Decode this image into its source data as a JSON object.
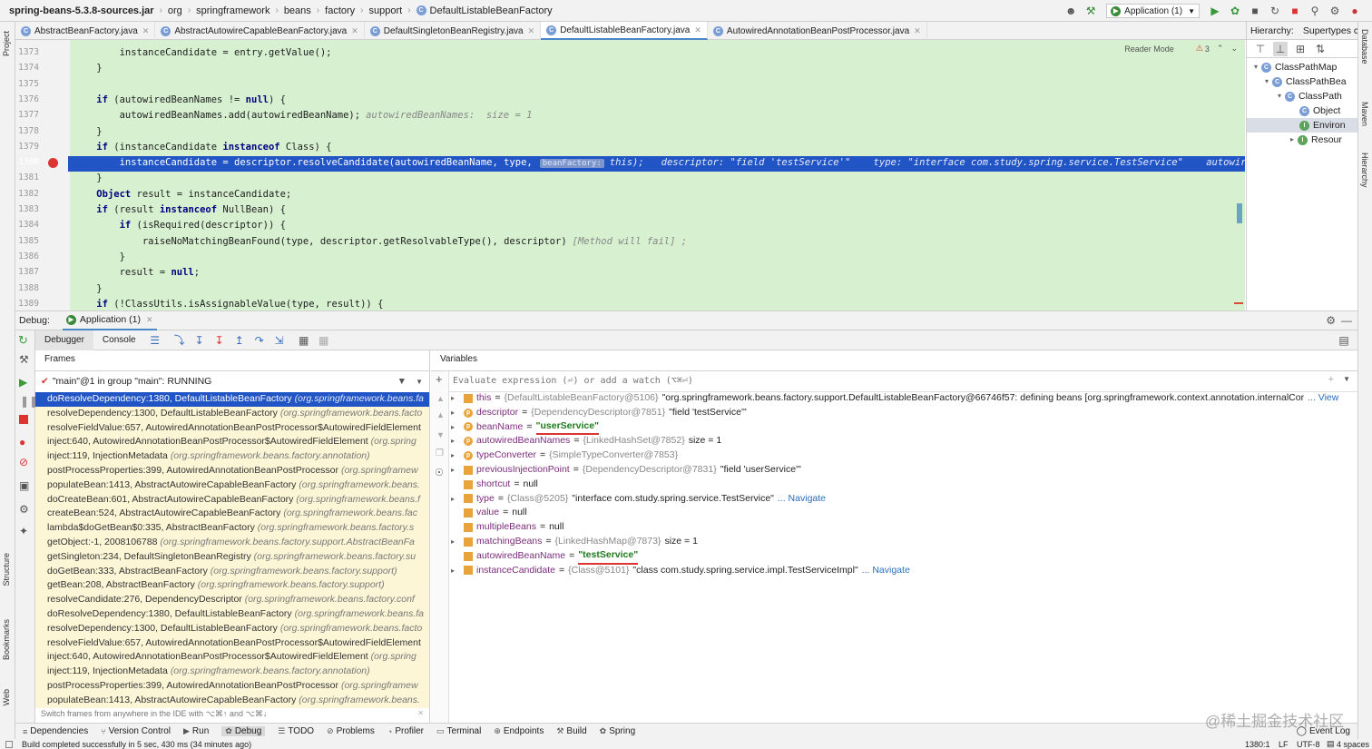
{
  "nav": {
    "breadcrumbs": [
      "spring-beans-5.3.8-sources.jar",
      "org",
      "springframework",
      "beans",
      "factory",
      "support",
      "DefaultListableBeanFactory"
    ],
    "run_config": "Application (1)"
  },
  "tabs": [
    "AbstractBeanFactory.java",
    "AbstractAutowireCapableBeanFactory.java",
    "DefaultSingletonBeanRegistry.java",
    "DefaultListableBeanFactory.java",
    "AutowiredAnnotationBeanPostProcessor.java"
  ],
  "left_tools": [
    "Project",
    "Structure",
    "Bookmarks",
    "Web"
  ],
  "right_tools": [
    "Database",
    "Maven",
    "Hierarchy"
  ],
  "editor": {
    "reader_mode": "Reader Mode",
    "warnings": "3",
    "lines": [
      {
        "n": "1373",
        "text": "        instanceCandidate = entry.getValue();"
      },
      {
        "n": "1374",
        "text": "    }"
      },
      {
        "n": "1375",
        "text": ""
      },
      {
        "n": "1376",
        "text": "    if (autowiredBeanNames != null) {"
      },
      {
        "n": "1377",
        "text": "        autowiredBeanNames.add(autowiredBeanName);",
        "hint": "autowiredBeanNames:  size = 1"
      },
      {
        "n": "1378",
        "text": "    }"
      },
      {
        "n": "1379",
        "text": "    if (instanceCandidate instanceof Class) {"
      },
      {
        "n": "1380",
        "text": "        instanceCandidate = descriptor.resolveCandidate(autowiredBeanName, type,",
        "hint": "this);   descriptor: \"field 'testService'\"    type: \"interface com.study.spring.service.TestService\"    autowir"
      },
      {
        "n": "1381",
        "text": "    }"
      },
      {
        "n": "1382",
        "text": "    Object result = instanceCandidate;"
      },
      {
        "n": "1383",
        "text": "    if (result instanceof NullBean) {"
      },
      {
        "n": "1384",
        "text": "        if (isRequired(descriptor)) {"
      },
      {
        "n": "1385",
        "text": "            raiseNoMatchingBeanFound(type, descriptor.getResolvableType(), descriptor)",
        "hint": "[Method will fail] ;"
      },
      {
        "n": "1386",
        "text": "        }"
      },
      {
        "n": "1387",
        "text": "        result = null;"
      },
      {
        "n": "1388",
        "text": "    }"
      },
      {
        "n": "1389",
        "text": "    if (!ClassUtils.isAssignableValue(type, result)) {"
      }
    ],
    "inlay_param": "beanFactory:"
  },
  "hierarchy": {
    "title": "Hierarchy:",
    "tab": "Supertypes c",
    "items": [
      "ClassPathMap",
      "ClassPathBea",
      "ClassPath",
      "Object",
      "Environ",
      "Resour"
    ]
  },
  "debug": {
    "label": "Debug:",
    "session": "Application (1)",
    "tabs": [
      "Debugger",
      "Console"
    ],
    "frames_title": "Frames",
    "thread": "\"main\"@1 in group \"main\": RUNNING",
    "frames": [
      {
        "m": "doResolveDependency:1380, DefaultListableBeanFactory",
        "p": "(org.springframework.beans.fa"
      },
      {
        "m": "resolveDependency:1300, DefaultListableBeanFactory",
        "p": "(org.springframework.beans.facto"
      },
      {
        "m": "resolveFieldValue:657, AutowiredAnnotationBeanPostProcessor$AutowiredFieldElement",
        "p": ""
      },
      {
        "m": "inject:640, AutowiredAnnotationBeanPostProcessor$AutowiredFieldElement",
        "p": "(org.spring"
      },
      {
        "m": "inject:119, InjectionMetadata",
        "p": "(org.springframework.beans.factory.annotation)"
      },
      {
        "m": "postProcessProperties:399, AutowiredAnnotationBeanPostProcessor",
        "p": "(org.springframew"
      },
      {
        "m": "populateBean:1413, AbstractAutowireCapableBeanFactory",
        "p": "(org.springframework.beans."
      },
      {
        "m": "doCreateBean:601, AbstractAutowireCapableBeanFactory",
        "p": "(org.springframework.beans.f"
      },
      {
        "m": "createBean:524, AbstractAutowireCapableBeanFactory",
        "p": "(org.springframework.beans.fac"
      },
      {
        "m": "lambda$doGetBean$0:335, AbstractBeanFactory",
        "p": "(org.springframework.beans.factory.s"
      },
      {
        "m": "getObject:-1, 2008106788",
        "p": "(org.springframework.beans.factory.support.AbstractBeanFa"
      },
      {
        "m": "getSingleton:234, DefaultSingletonBeanRegistry",
        "p": "(org.springframework.beans.factory.su"
      },
      {
        "m": "doGetBean:333, AbstractBeanFactory",
        "p": "(org.springframework.beans.factory.support)"
      },
      {
        "m": "getBean:208, AbstractBeanFactory",
        "p": "(org.springframework.beans.factory.support)"
      },
      {
        "m": "resolveCandidate:276, DependencyDescriptor",
        "p": "(org.springframework.beans.factory.conf"
      },
      {
        "m": "doResolveDependency:1380, DefaultListableBeanFactory",
        "p": "(org.springframework.beans.fa"
      },
      {
        "m": "resolveDependency:1300, DefaultListableBeanFactory",
        "p": "(org.springframework.beans.facto"
      },
      {
        "m": "resolveFieldValue:657, AutowiredAnnotationBeanPostProcessor$AutowiredFieldElement",
        "p": ""
      },
      {
        "m": "inject:640, AutowiredAnnotationBeanPostProcessor$AutowiredFieldElement",
        "p": "(org.spring"
      },
      {
        "m": "inject:119, InjectionMetadata",
        "p": "(org.springframework.beans.factory.annotation)"
      },
      {
        "m": "postProcessProperties:399, AutowiredAnnotationBeanPostProcessor",
        "p": "(org.springframew"
      },
      {
        "m": "populateBean:1413, AbstractAutowireCapableBeanFactory",
        "p": "(org.springframework.beans."
      }
    ],
    "frames_tip": "Switch frames from anywhere in the IDE with ⌥⌘↑ and ⌥⌘↓",
    "vars_title": "Variables",
    "eval_placeholder": "Evaluate expression (⏎) or add a watch (⌥⌘⏎)",
    "vars": [
      {
        "exp": true,
        "icon": "f",
        "name": "this",
        "type": "{DefaultListableBeanFactory@5106}",
        "val": "\"org.springframework.beans.factory.support.DefaultListableBeanFactory@66746f57: defining beans [org.springframework.context.annotation.internalCor",
        "link": "... View"
      },
      {
        "exp": true,
        "icon": "p",
        "name": "descriptor",
        "type": "{DependencyDescriptor@7851}",
        "val": "\"field 'testService'\"",
        "link": ""
      },
      {
        "exp": true,
        "icon": "p",
        "name": "beanName",
        "type": "",
        "str": "\"userService\"",
        "link": ""
      },
      {
        "exp": true,
        "icon": "p",
        "name": "autowiredBeanNames",
        "type": "{LinkedHashSet@7852}",
        "val": " size = 1",
        "link": ""
      },
      {
        "exp": true,
        "icon": "p",
        "name": "typeConverter",
        "type": "{SimpleTypeConverter@7853}",
        "val": "",
        "link": ""
      },
      {
        "exp": true,
        "icon": "f",
        "name": "previousInjectionPoint",
        "type": "{DependencyDescriptor@7831}",
        "val": "\"field 'userService'\"",
        "link": ""
      },
      {
        "exp": false,
        "icon": "f",
        "name": "shortcut",
        "type": "",
        "val": "null",
        "link": ""
      },
      {
        "exp": true,
        "icon": "f",
        "name": "type",
        "type": "{Class@5205}",
        "val": "\"interface com.study.spring.service.TestService\"",
        "link": "... Navigate"
      },
      {
        "exp": false,
        "icon": "f",
        "name": "value",
        "type": "",
        "val": "null",
        "link": ""
      },
      {
        "exp": false,
        "icon": "f",
        "name": "multipleBeans",
        "type": "",
        "val": "null",
        "link": ""
      },
      {
        "exp": true,
        "icon": "f",
        "name": "matchingBeans",
        "type": "{LinkedHashMap@7873}",
        "val": " size = 1",
        "link": ""
      },
      {
        "exp": false,
        "icon": "f",
        "name": "autowiredBeanName",
        "type": "",
        "str": "\"testService\"",
        "link": ""
      },
      {
        "exp": true,
        "icon": "f",
        "name": "instanceCandidate",
        "type": "{Class@5101}",
        "val": "\"class com.study.spring.service.impl.TestServiceImpl\"",
        "link": "... Navigate"
      }
    ]
  },
  "bottom_tools": [
    "Dependencies",
    "Version Control",
    "Run",
    "Debug",
    "TODO",
    "Problems",
    "Profiler",
    "Terminal",
    "Endpoints",
    "Build",
    "Spring"
  ],
  "event_log": "Event Log",
  "watermark": "@稀土掘金技术社区",
  "status": {
    "message": "Build completed successfully in 5 sec, 430 ms (34 minutes ago)",
    "position": "1380:1",
    "lf": "LF",
    "encoding": "UTF-8",
    "indent": "4 spaces"
  }
}
